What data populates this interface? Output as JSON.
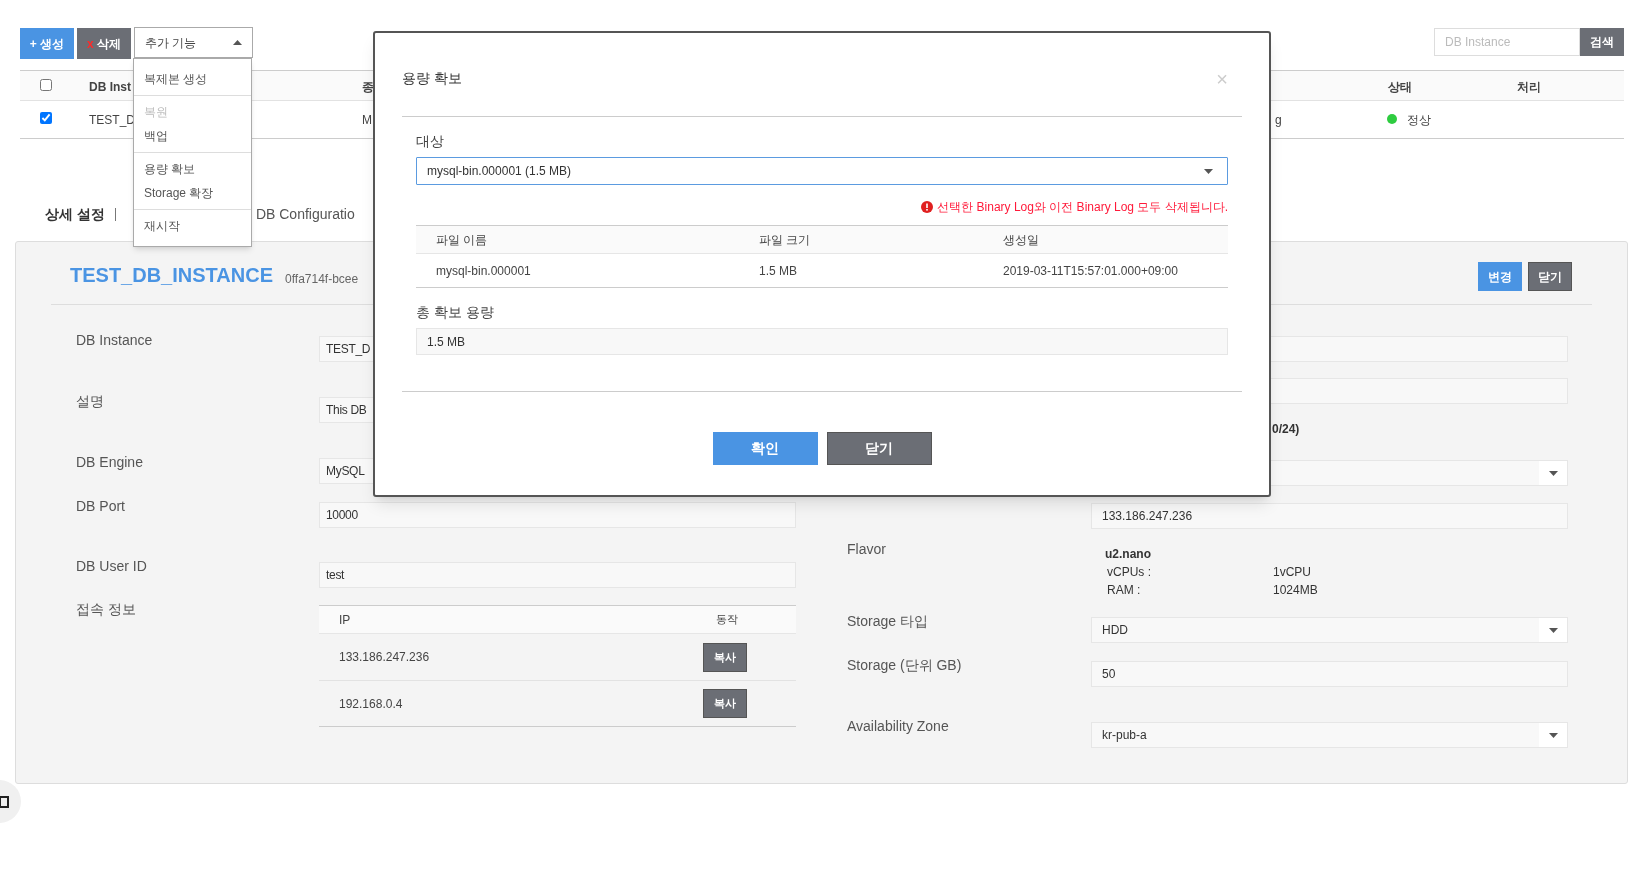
{
  "toolbar": {
    "create_button": "+ 생성",
    "delete_button": {
      "mark": "x",
      "label": "삭제"
    }
  },
  "more_menu": {
    "label": "추가 기능",
    "expanded": true,
    "groups": [
      [
        {
          "label": "복제본 생성",
          "disabled": false
        }
      ],
      [
        {
          "label": "복원",
          "disabled": true
        },
        {
          "label": "백업",
          "disabled": false
        }
      ],
      [
        {
          "label": "용량 확보",
          "disabled": false
        },
        {
          "label": "Storage 확장",
          "disabled": false
        }
      ],
      [
        {
          "label": "재시작",
          "disabled": false
        }
      ]
    ]
  },
  "search": {
    "placeholder": "DB Instance",
    "button": "검색"
  },
  "instance_table": {
    "all_checked": false,
    "columns": [
      "DB Inst",
      "종",
      "상태",
      "처리"
    ],
    "rows": [
      {
        "checked": true,
        "name": "TEST_D",
        "column_2": "M",
        "column_3": "g",
        "status": "정상",
        "color": "#2ecc40"
      }
    ]
  },
  "detail_tabs": [
    {
      "label": "상세 설정",
      "selected": true
    },
    {
      "label": "DB Configuratio",
      "selected": false
    }
  ],
  "detail": {
    "title": "TEST_DB_INSTANCE",
    "id": "0ffa714f-bcee",
    "buttons": [
      {
        "label": "변경",
        "kind": "primary"
      },
      {
        "label": "닫기",
        "kind": "secondary"
      }
    ],
    "left_fields": [
      {
        "label": "DB Instance",
        "value": "TEST_D"
      },
      {
        "label": "설명",
        "value": "This DB"
      },
      {
        "label": "DB Engine",
        "value": "MySQL"
      },
      {
        "label": "DB Port",
        "value": "10000"
      },
      {
        "label": "DB User ID",
        "value": "test"
      }
    ],
    "connection": {
      "label": "접속 정보",
      "columns": [
        "IP",
        "동작"
      ],
      "rows": [
        {
          "ip": "133.186.247.236",
          "action": "복사"
        },
        {
          "ip": "192.168.0.4",
          "action": "복사"
        }
      ]
    },
    "right_fields": [
      {
        "kind": "input"
      },
      {
        "kind": "input"
      },
      {
        "kind": "note",
        "value": "0/24)"
      },
      {
        "kind": "select"
      },
      {
        "kind": "input",
        "value": "133.186.247.236"
      },
      {
        "kind": "flavor",
        "label": "Flavor",
        "name": "u2.nano",
        "specs": [
          {
            "key": "vCPUs :",
            "value": "1vCPU"
          },
          {
            "key": "RAM :",
            "value": "1024MB"
          }
        ]
      },
      {
        "kind": "select",
        "label": "Storage 타입",
        "value": "HDD"
      },
      {
        "kind": "input",
        "label": "Storage (단위 GB)",
        "value": "50"
      },
      {
        "kind": "select",
        "label": "Availability Zone",
        "value": "kr-pub-a"
      }
    ]
  },
  "modal": {
    "title": "용량 확보",
    "close": "×",
    "target_label": "대상",
    "target_value": "mysql-bin.000001 (1.5 MB)",
    "warning": "선택한 Binary Log와 이전 Binary Log 모두 삭제됩니다.",
    "columns": [
      "파일 이름",
      "파일 크기",
      "생성일"
    ],
    "rows": [
      [
        "mysql-bin.000001",
        "1.5 MB",
        "2019-03-11T15:57:01.000+09:00"
      ]
    ],
    "total_label": "총 확보 용량",
    "total_value": "1.5 MB",
    "buttons": [
      {
        "label": "확인",
        "kind": "primary"
      },
      {
        "label": "닫기",
        "kind": "secondary"
      }
    ]
  }
}
